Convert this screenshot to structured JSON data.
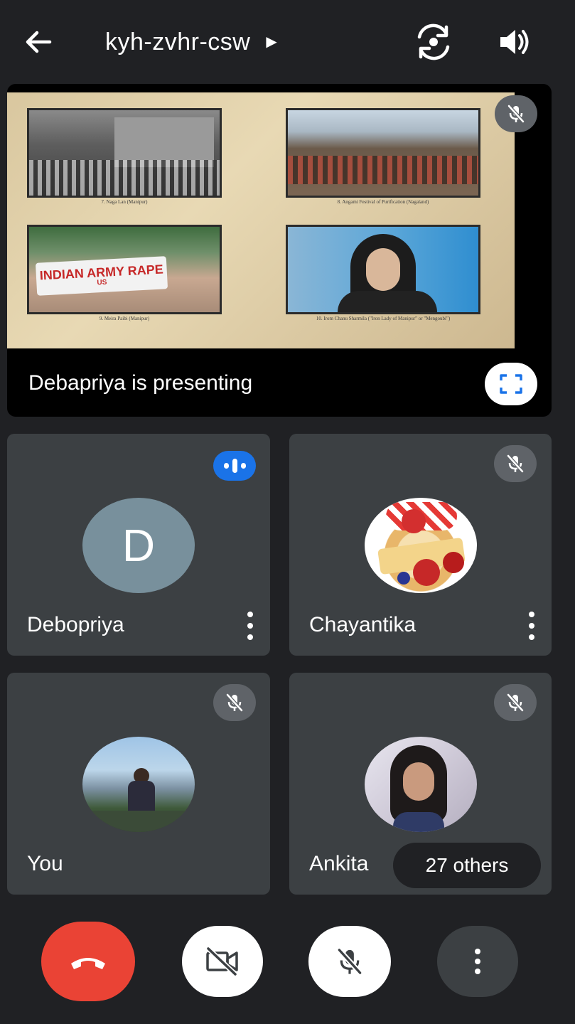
{
  "meeting": {
    "code": "kyh-zvhr-csw"
  },
  "presentation": {
    "status_text": "Debapriya is presenting",
    "slide": {
      "captions": [
        "7. Naga Lan (Manipur)",
        "8. Angami Festival of Purification (Nagaland)",
        "9. Meira Paibi (Manipur)",
        "10. Irom Chanu Sharmila (\"Iron Lady of Manipur\" or \"Mengoubi\")"
      ],
      "banner_text_line1": "INDIAN ARMY RAPE",
      "banner_text_line2": "US"
    }
  },
  "participants": [
    {
      "name": "Debopriya",
      "avatar_letter": "D",
      "status": "speaking"
    },
    {
      "name": "Chayantika",
      "status": "muted"
    },
    {
      "name": "You",
      "status": "muted"
    },
    {
      "name": "Ankita",
      "status": "muted"
    }
  ],
  "others_count_label": "27 others",
  "colors": {
    "background": "#202124",
    "tile": "#3c4043",
    "end_call": "#ea4335",
    "speaking": "#1a73e8",
    "avatar_letter_bg": "#78909c"
  },
  "icons": {
    "back": "arrow-left-icon",
    "switch_camera": "switch-camera-icon",
    "speaker": "speaker-icon",
    "mic_off": "mic-off-icon",
    "fullscreen": "fullscreen-icon",
    "more": "more-vert-icon",
    "end_call": "phone-hangup-icon",
    "camera_off": "camera-off-icon"
  }
}
